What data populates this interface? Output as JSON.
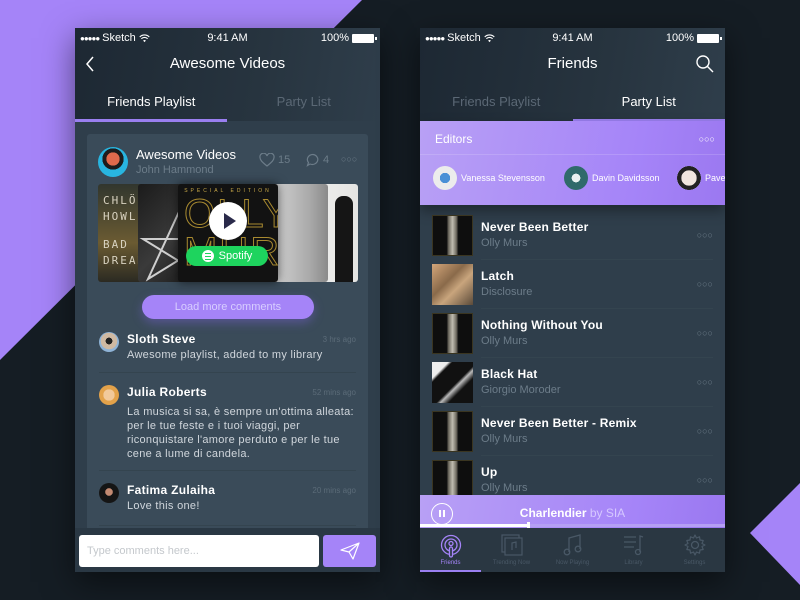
{
  "colors": {
    "accent": "#a584f8",
    "background": "#151d24",
    "phone_bg": "#2f3e4b",
    "spotify_green": "#1ed45e"
  },
  "left_screen": {
    "status_bar": {
      "carrier": "Sketch",
      "time": "9:41 AM",
      "battery": "100%"
    },
    "title": "Awesome Videos",
    "tabs": [
      {
        "label": "Friends Playlist",
        "active": true
      },
      {
        "label": "Party List",
        "active": false
      }
    ],
    "post": {
      "title": "Awesome Videos",
      "author": "John Hammond",
      "likes": "15",
      "comments_count": "4",
      "covers": [
        {
          "lines": [
            "CHLÖE",
            "HOWL",
            "BAD",
            "DREAM"
          ]
        },
        {
          "lines": []
        },
        {
          "lines": [
            "SPECIAL EDITION",
            "OLLY MURS"
          ]
        },
        {
          "lines": []
        },
        {
          "lines": []
        }
      ],
      "spotify_label": "Spotify",
      "load_more_label": "Load more comments"
    },
    "comments": [
      {
        "name": "Sloth Steve",
        "time": "3 hrs ago",
        "text": "Awesome playlist, added to my library"
      },
      {
        "name": "Julia Roberts",
        "time": "52 mins ago",
        "text": "La musica si sa, è sempre un'ottima alleata: per le tue feste e i tuoi viaggi, per riconquistare l'amore perduto e per le tue cene a lume di candela."
      },
      {
        "name": "Fatima Zulaiha",
        "time": "20 mins ago",
        "text": "Love this one!"
      }
    ],
    "comment_input": {
      "placeholder": "Type comments here...",
      "value": ""
    }
  },
  "right_screen": {
    "status_bar": {
      "carrier": "Sketch",
      "time": "9:41 AM",
      "battery": "100%"
    },
    "title": "Friends",
    "tabs": [
      {
        "label": "Friends Playlist",
        "active": false
      },
      {
        "label": "Party List",
        "active": true
      }
    ],
    "editors": {
      "title": "Editors",
      "people": [
        {
          "name": "Vanessa Stevensson"
        },
        {
          "name": "Davin Davidsson"
        },
        {
          "name": "Pave"
        }
      ]
    },
    "tracks": [
      {
        "title": "Never Been Better",
        "artist": "Olly Murs"
      },
      {
        "title": "Latch",
        "artist": "Disclosure"
      },
      {
        "title": "Nothing Without You",
        "artist": "Olly Murs"
      },
      {
        "title": "Black Hat",
        "artist": "Giorgio Moroder"
      },
      {
        "title": "Never Been Better - Remix",
        "artist": "Olly Murs"
      },
      {
        "title": "Up",
        "artist": "Olly Murs"
      }
    ],
    "now_playing": {
      "song": "Charlendier",
      "by": "by SIA",
      "progress_percent": 35
    },
    "tabbar": [
      {
        "label": "Friends",
        "icon": "podcast-icon",
        "active": true
      },
      {
        "label": "Trending Now",
        "icon": "music-album-icon",
        "active": false
      },
      {
        "label": "Now Playing",
        "icon": "music-note-icon",
        "active": false
      },
      {
        "label": "Library",
        "icon": "library-icon",
        "active": false
      },
      {
        "label": "Settings",
        "icon": "gear-icon",
        "active": false
      }
    ]
  }
}
